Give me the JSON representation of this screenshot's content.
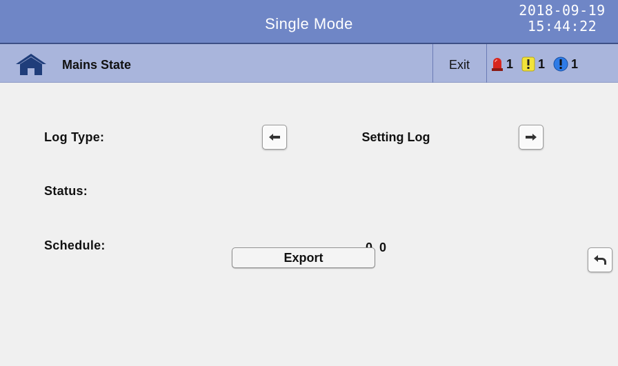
{
  "header": {
    "title": "Single Mode",
    "date": "2018-09-19",
    "time": "15:44:22"
  },
  "subheader": {
    "home_icon": "home-icon",
    "state": "Mains State",
    "exit_label": "Exit",
    "alarms": [
      {
        "icon": "siren-alarm-icon",
        "count": "1",
        "color": "#d7261e"
      },
      {
        "icon": "warning-exclamation-icon",
        "count": "1",
        "color": "#f2e33a"
      },
      {
        "icon": "info-exclamation-icon",
        "count": "1",
        "color": "#2e7be6"
      }
    ]
  },
  "main": {
    "log_type_label": "Log Type:",
    "log_type_value": "Setting Log",
    "status_label": "Status:",
    "status_value": "",
    "schedule_label": "Schedule:",
    "schedule_value": "0. 0",
    "prev_icon": "arrow-left-icon",
    "next_icon": "arrow-right-icon"
  },
  "footer": {
    "export_label": "Export",
    "back_icon": "return-arrow-icon"
  },
  "colors": {
    "header_bg": "#6f86c6",
    "subheader_bg": "#a9b5dc",
    "content_bg": "#f0f0f0",
    "home_icon": "#1f3d7a"
  }
}
